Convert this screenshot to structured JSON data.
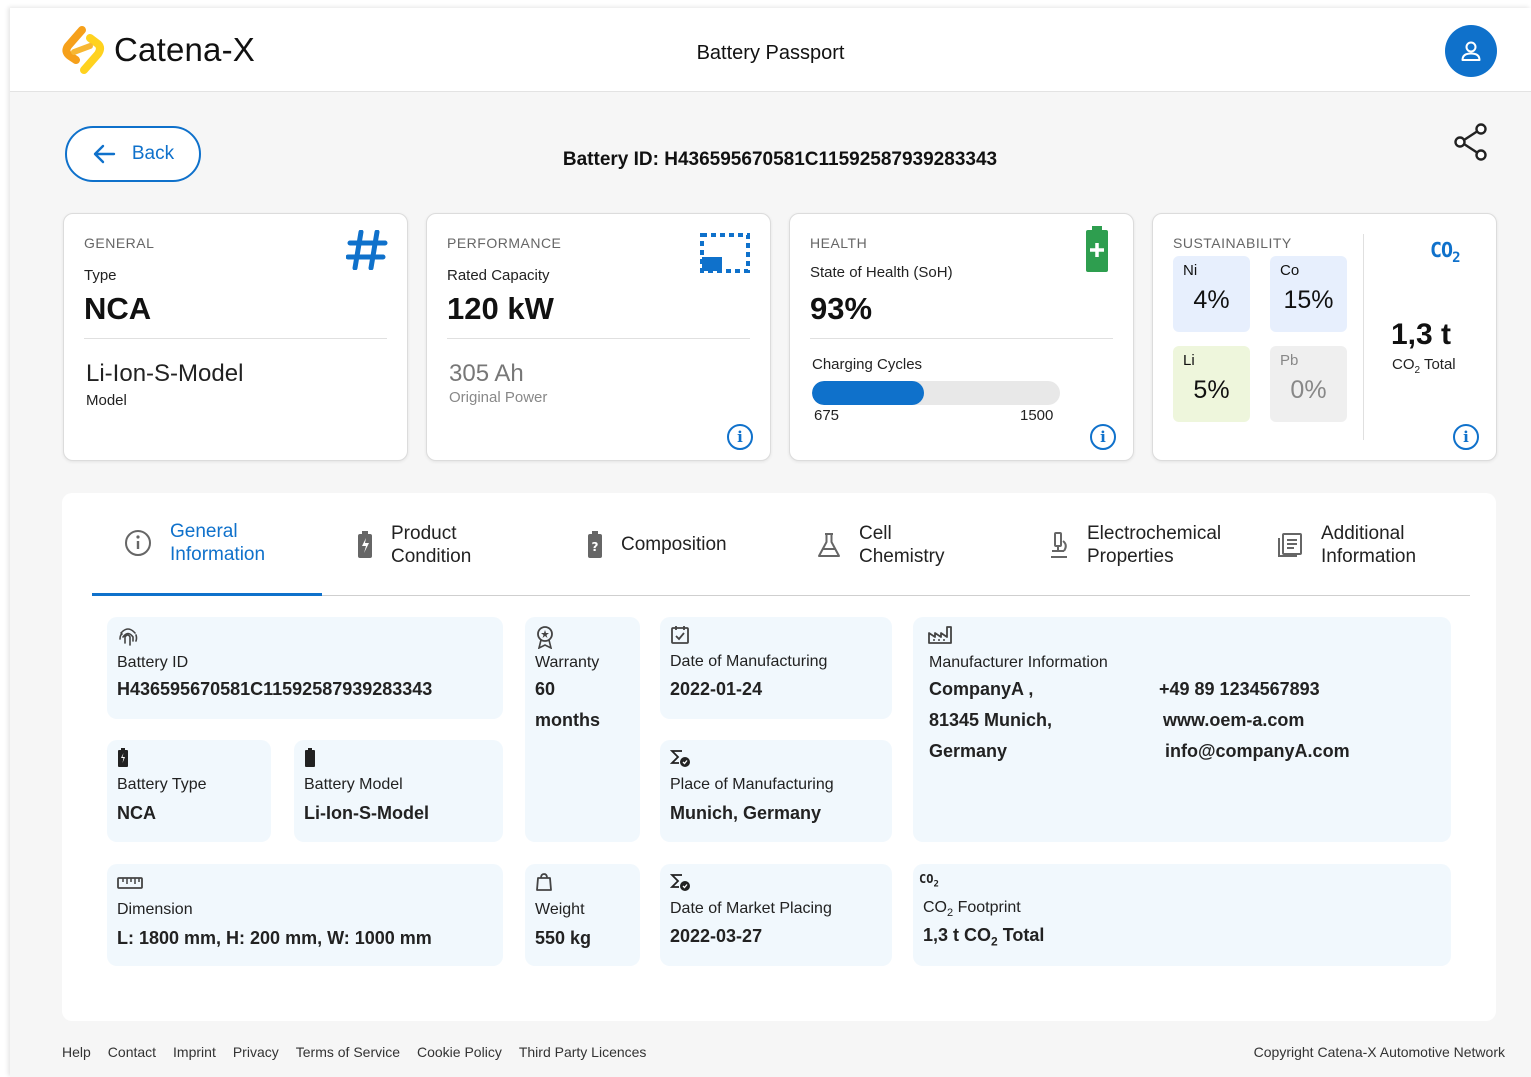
{
  "header": {
    "brand": "Catena-X",
    "title": "Battery Passport",
    "avatar_icon": "user-icon"
  },
  "toolbar": {
    "back_label": "Back",
    "battery_id_label": "Battery ID:",
    "battery_id_value": "H436595670581C11592587939283343",
    "share_icon": "share-icon"
  },
  "cards": {
    "general": {
      "category": "GENERAL",
      "type_label": "Type",
      "type_value": "NCA",
      "model_value": "Li-Ion-S-Model",
      "model_label": "Model",
      "icon": "hash-icon"
    },
    "performance": {
      "category": "PERFORMANCE",
      "capacity_label": "Rated Capacity",
      "capacity_value": "120 kW",
      "power_value": "305 Ah",
      "power_label": "Original Power",
      "icon": "capacity-icon"
    },
    "health": {
      "category": "HEALTH",
      "soh_label": "State of Health (SoH)",
      "soh_value": "93%",
      "cycles_label": "Charging Cycles",
      "cycles_value": "675",
      "cycles_max": "1500",
      "cycles_fraction": 0.45,
      "icon": "battery-plus-icon"
    },
    "sustainability": {
      "category": "SUSTAINABILITY",
      "materials": [
        {
          "symbol": "Ni",
          "value": "4%",
          "color": "#e7effd"
        },
        {
          "symbol": "Co",
          "value": "15%",
          "color": "#e7effd"
        },
        {
          "symbol": "Li",
          "value": "5%",
          "color": "#eef6dc"
        },
        {
          "symbol": "Pb",
          "value": "0%",
          "color": "#efefef"
        }
      ],
      "co2_badge": "CO",
      "co2_badge_sub": "2",
      "co2_value": "1,3 t",
      "co2_label": "CO",
      "co2_label_sub": "2",
      "co2_label_rest": " Total"
    }
  },
  "tabs": [
    {
      "label_line1": "General",
      "label_line2": "Information",
      "icon": "info-icon"
    },
    {
      "label_line1": "Product",
      "label_line2": "Condition",
      "icon": "battery-charge-icon"
    },
    {
      "label_line1": "Composition",
      "label_line2": "",
      "icon": "battery-question-icon"
    },
    {
      "label_line1": "Cell",
      "label_line2": "Chemistry",
      "icon": "flask-icon"
    },
    {
      "label_line1": "Electrochemical",
      "label_line2": "Properties",
      "icon": "microscope-icon"
    },
    {
      "label_line1": "Additional",
      "label_line2": "Information",
      "icon": "document-icon"
    }
  ],
  "general_info": {
    "battery_id": {
      "label": "Battery ID",
      "value": "H436595670581C11592587939283343",
      "icon": "fingerprint-icon"
    },
    "warranty": {
      "label": "Warranty",
      "value_line1": "60",
      "value_line2": "months",
      "icon": "award-icon"
    },
    "date_manufacturing": {
      "label": "Date of Manufacturing",
      "value": "2022-01-24",
      "icon": "calendar-check-icon"
    },
    "manufacturer": {
      "label": "Manufacturer Information",
      "address_line1": "CompanyA ,",
      "address_line2": "81345 Munich,",
      "address_line3": "Germany",
      "phone": "+49 89 1234567893",
      "website": "www.oem-a.com",
      "email": "info@companyA.com",
      "icon": "factory-icon"
    },
    "battery_type": {
      "label": "Battery Type",
      "value": "NCA",
      "icon": "battery-icon"
    },
    "battery_model": {
      "label": "Battery Model",
      "value": "Li-Ion-S-Model",
      "icon": "battery-full-icon"
    },
    "place_manufacturing": {
      "label": "Place of Manufacturing",
      "value": "Munich, Germany",
      "icon": "location-sigma-icon"
    },
    "dimension": {
      "label": "Dimension",
      "value": "L: 1800 mm, H: 200 mm, W: 1000 mm",
      "icon": "ruler-icon"
    },
    "weight": {
      "label": "Weight",
      "value": "550 kg",
      "icon": "weight-icon"
    },
    "market_placing": {
      "label": "Date of Market Placing",
      "value": "2022-03-27",
      "icon": "market-sigma-icon"
    },
    "co2_footprint": {
      "label_pre": "CO",
      "label_sub": "2",
      "label_post": " Footprint",
      "value_pre": "1,3 t CO",
      "value_sub": "2",
      "value_post": " Total",
      "badge": "CO",
      "badge_sub": "2"
    }
  },
  "footer": {
    "links": [
      "Help",
      "Contact",
      "Imprint",
      "Privacy",
      "Terms of Service",
      "Cookie Policy",
      "Third Party Licences"
    ],
    "copyright": "Copyright Catena-X Automotive Network"
  },
  "colors": {
    "accent": "#0f71cb",
    "health_green": "#2e9e4f",
    "logo_orange": "#f6a01a",
    "logo_yellow": "#ffd21f"
  }
}
